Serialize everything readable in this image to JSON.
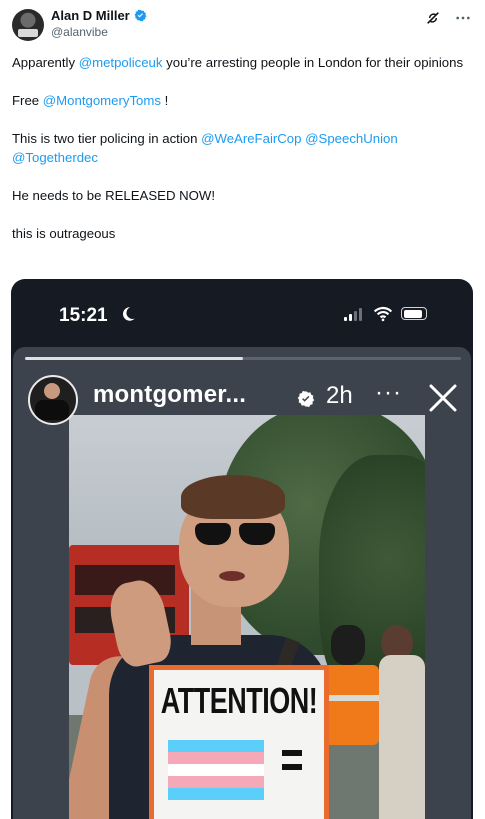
{
  "author": {
    "name": "Alan D Miller",
    "handle": "@alanvibe",
    "verified": true,
    "badge_color": "#1d9bf0"
  },
  "header_icons": [
    "grok-icon",
    "more-icon"
  ],
  "tweet": {
    "line1_before": "Apparently ",
    "line1_mention": "@metpoliceuk",
    "line1_after": " you’re arresting people in London for their opinions",
    "line2_before": "Free ",
    "line2_mention": "@MontgomeryToms",
    "line2_after": " !",
    "line3_before": "This is two tier policing in action ",
    "line3_mention1": "@WeAreFairCop",
    "line3_mention2": "@SpeechUnion",
    "line3_mention3": "@Togetherdec",
    "line4": "He needs to be RELEASED NOW!",
    "line5": "this is outrageous",
    "mention_color": "#1d9bf0"
  },
  "media": {
    "status_time": "15:21",
    "story_user": "montgomer...",
    "story_age": "2h",
    "story_more": "···",
    "story_progress": 0.5,
    "sign_text": "ATTENTION!",
    "flag_colors": [
      "#5bcefa",
      "#f5a9b8",
      "#ffffff",
      "#f5a9b8",
      "#5bcefa"
    ]
  }
}
